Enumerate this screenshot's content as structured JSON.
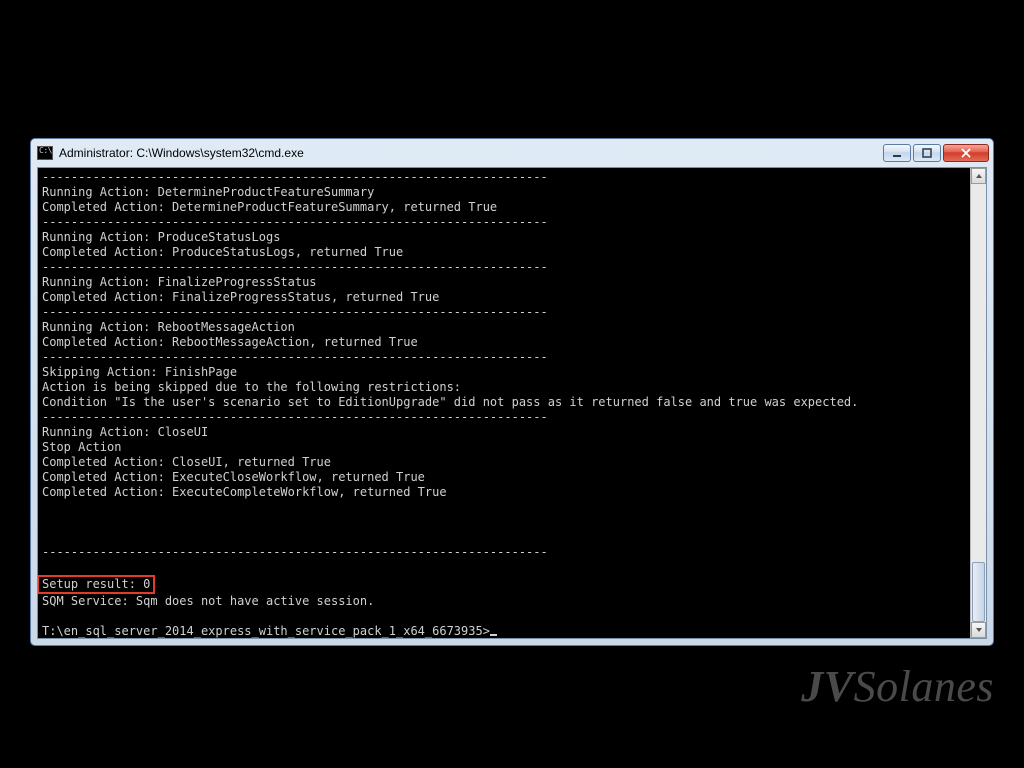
{
  "window": {
    "title": "Administrator: C:\\Windows\\system32\\cmd.exe"
  },
  "console": {
    "sep": "----------------------------------------------------------------------",
    "l01": "Running Action: DetermineProductFeatureSummary",
    "l02": "Completed Action: DetermineProductFeatureSummary, returned True",
    "l03": "Running Action: ProduceStatusLogs",
    "l04": "Completed Action: ProduceStatusLogs, returned True",
    "l05": "Running Action: FinalizeProgressStatus",
    "l06": "Completed Action: FinalizeProgressStatus, returned True",
    "l07": "Running Action: RebootMessageAction",
    "l08": "Completed Action: RebootMessageAction, returned True",
    "l09": "Skipping Action: FinishPage",
    "l10": "Action is being skipped due to the following restrictions:",
    "l11": "Condition \"Is the user's scenario set to EditionUpgrade\" did not pass as it returned false and true was expected.",
    "l12": "Running Action: CloseUI",
    "l13": "Stop Action",
    "l14": "Completed Action: CloseUI, returned True",
    "l15": "Completed Action: ExecuteCloseWorkflow, returned True",
    "l16": "Completed Action: ExecuteCompleteWorkflow, returned True",
    "l17": "Setup result: 0",
    "l18": "SQM Service: Sqm does not have active session.",
    "prompt": "T:\\en_sql_server_2014_express_with_service_pack_1_x64_6673935>"
  },
  "watermark": {
    "jv": "JV",
    "rest": "Solanes"
  }
}
